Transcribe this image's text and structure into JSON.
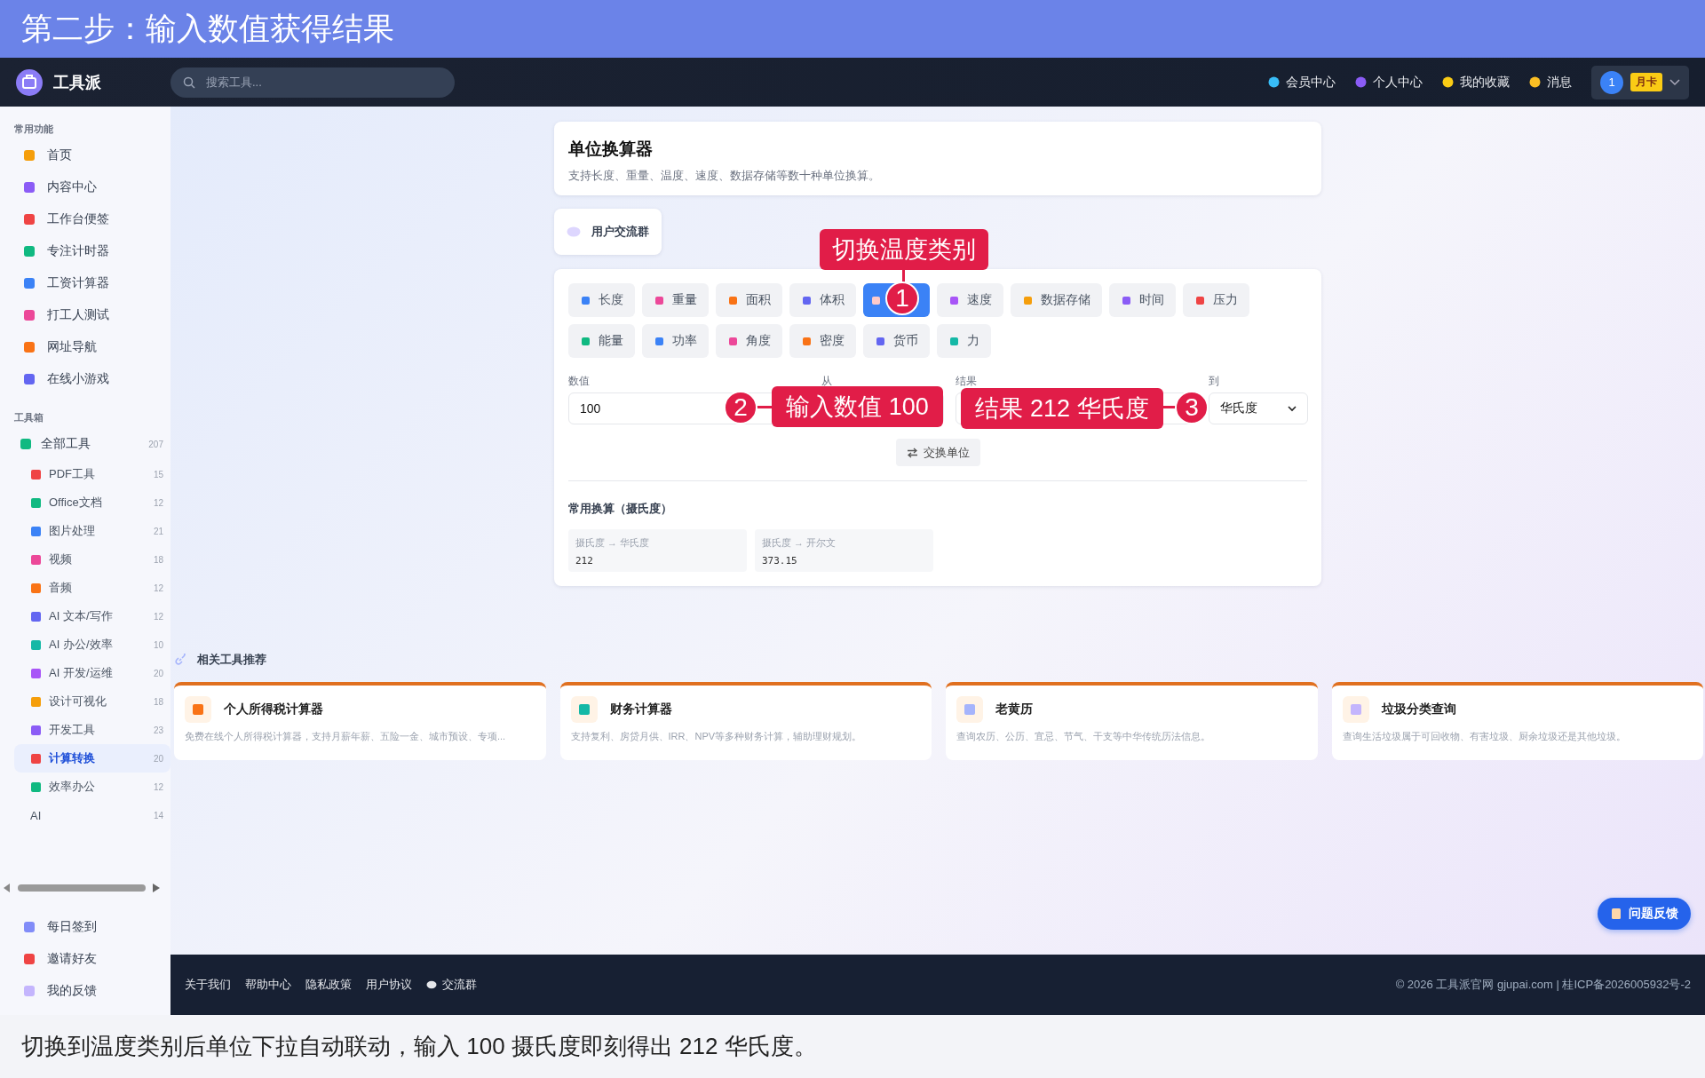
{
  "banner": {
    "title": "第二步：输入数值获得结果"
  },
  "header": {
    "logo": "工具派",
    "search": {
      "placeholder": "搜索工具..."
    },
    "nav": [
      "会员中心",
      "个人中心",
      "我的收藏",
      "消息"
    ],
    "user": {
      "avatar": "1",
      "badge": "月卡"
    }
  },
  "sidebar": {
    "sections": [
      {
        "title": "常用功能",
        "items": [
          {
            "label": "首页",
            "selected": false
          },
          {
            "label": "内容中心",
            "selected": false
          },
          {
            "label": "工作台便签",
            "selected": false
          },
          {
            "label": "专注计时器",
            "selected": false
          },
          {
            "label": "工资计算器",
            "selected": false
          },
          {
            "label": "打工人测试",
            "selected": false
          },
          {
            "label": "网址导航",
            "selected": false
          },
          {
            "label": "在线小游戏",
            "selected": false
          }
        ]
      },
      {
        "title": "工具箱",
        "items": [
          {
            "label": "全部工具",
            "count": "207",
            "selected": false,
            "children": [
              {
                "label": "PDF工具",
                "count": "15",
                "selected": false,
                "kind": "tool"
              },
              {
                "label": "Office文档",
                "count": "12",
                "selected": false,
                "kind": "tool"
              },
              {
                "label": "图片处理",
                "count": "21",
                "selected": false,
                "kind": "tool"
              },
              {
                "label": "视频",
                "count": "18",
                "selected": false,
                "kind": "tool"
              },
              {
                "label": "音频",
                "count": "12",
                "selected": false,
                "kind": "tool"
              },
              {
                "label": "AI 文本/写作",
                "count": "12",
                "selected": false,
                "kind": "tool"
              },
              {
                "label": "AI 办公/效率",
                "count": "10",
                "selected": false,
                "kind": "tool"
              },
              {
                "label": "AI 开发/运维",
                "count": "20",
                "selected": false,
                "kind": "tool"
              },
              {
                "label": "设计可视化",
                "count": "18",
                "selected": false,
                "kind": "tool"
              },
              {
                "label": "开发工具",
                "count": "23",
                "selected": false,
                "kind": "tool"
              },
              {
                "label": "计算转换",
                "count": "20",
                "selected": true,
                "kind": "tool"
              },
              {
                "label": "效率办公",
                "count": "12",
                "selected": false,
                "kind": "tool"
              },
              {
                "label": "AI",
                "count": "14",
                "selected": false,
                "kind": "text"
              }
            ]
          }
        ]
      }
    ],
    "bottom_items": [
      "每日签到",
      "邀请好友",
      "我的反馈"
    ]
  },
  "page": {
    "title": "单位换算器",
    "description": "支持长度、重量、温度、速度、数据存储等数十种单位换算。"
  },
  "group_button": "用户交流群",
  "converter": {
    "categories": [
      {
        "label": "长度",
        "selected": false
      },
      {
        "label": "重量",
        "selected": false
      },
      {
        "label": "面积",
        "selected": false
      },
      {
        "label": "体积",
        "selected": false
      },
      {
        "selected": true
      },
      {
        "label": "速度",
        "selected": false
      },
      {
        "label": "数据存储",
        "selected": false
      },
      {
        "label": "时间",
        "selected": false
      },
      {
        "label": "压力",
        "selected": false
      },
      {
        "label": "能量",
        "selected": false
      },
      {
        "label": "功率",
        "selected": false
      },
      {
        "label": "角度",
        "selected": false
      },
      {
        "label": "密度",
        "selected": false
      },
      {
        "label": "货币",
        "selected": false
      },
      {
        "label": "力",
        "selected": false
      }
    ],
    "value_label": "数值",
    "value": "100",
    "from_label": "从",
    "result_label": "结果",
    "to_label": "到",
    "to_unit": "华氏度",
    "swap_button": "交换单位",
    "common_title": "常用换算（摄氏度）",
    "common": [
      {
        "label": "摄氏度 → 华氏度",
        "value": "212"
      },
      {
        "label": "摄氏度 → 开尔文",
        "value": "373.15"
      }
    ]
  },
  "related": {
    "title": "相关工具推荐",
    "cards": [
      {
        "title": "个人所得税计算器",
        "description": "免费在线个人所得税计算器，支持月薪年薪、五险一金、城市预设、专项..."
      },
      {
        "title": "财务计算器",
        "description": "支持复利、房贷月供、IRR、NPV等多种财务计算，辅助理财规划。"
      },
      {
        "title": "老黄历",
        "description": "查询农历、公历、宜忌、节气、干支等中华传统历法信息。"
      },
      {
        "title": "垃圾分类查询",
        "description": "查询生活垃圾属于可回收物、有害垃圾、厨余垃圾还是其他垃圾。"
      }
    ]
  },
  "feedback_button": "问题反馈",
  "footer": {
    "links": [
      "关于我们",
      "帮助中心",
      "隐私政策",
      "用户协议"
    ],
    "group_link": "交流群",
    "copyright": "© 2026 工具派官网 gjupai.com | 桂ICP备2026005932号-2"
  },
  "annotations": [
    {
      "number": "1",
      "text": "切换温度类别"
    },
    {
      "number": "2",
      "text": "输入数值 100"
    },
    {
      "number": "3",
      "text": "结果 212 华氏度"
    }
  ],
  "caption": "切换到温度类别后单位下拉自动联动，输入 100 摄氏度即刻得出 212 华氏度。"
}
